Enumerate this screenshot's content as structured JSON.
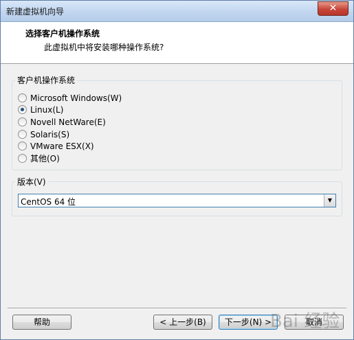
{
  "window": {
    "title": "新建虚拟机向导",
    "close": "✕"
  },
  "header": {
    "title": "选择客户机操作系统",
    "subtitle": "此虚拟机中将安装哪种操作系统?"
  },
  "os_group": {
    "label": "客户机操作系统",
    "options": [
      {
        "label": "Microsoft Windows(W)",
        "checked": false
      },
      {
        "label": "Linux(L)",
        "checked": true
      },
      {
        "label": "Novell NetWare(E)",
        "checked": false
      },
      {
        "label": "Solaris(S)",
        "checked": false
      },
      {
        "label": "VMware ESX(X)",
        "checked": false
      },
      {
        "label": "其他(O)",
        "checked": false
      }
    ]
  },
  "version_group": {
    "label": "版本(V)",
    "selected": "CentOS 64 位"
  },
  "buttons": {
    "help": "帮助",
    "back": "< 上一步(B)",
    "next": "下一步(N) >",
    "cancel": "取消"
  },
  "watermark": "Bai 经验"
}
